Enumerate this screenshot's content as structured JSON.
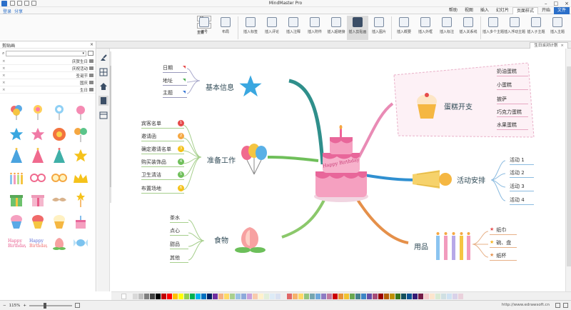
{
  "app": {
    "window_title": "MindMaster Pro",
    "quick_tools": [
      "undo",
      "redo",
      "save",
      "open"
    ]
  },
  "menubar": {
    "items": [
      "文件",
      "开始",
      "页面样式",
      "幻灯片",
      "插入",
      "视图",
      "帮助"
    ],
    "active": "页面样式",
    "left_tools": [
      "登录",
      "分享"
    ]
  },
  "ribbon": {
    "buttons": [
      "插入主题",
      "插入子主题",
      "插入浮动主题",
      "插入多个主题",
      "插入关系线",
      "插入标注",
      "插入外框",
      "插入概要",
      "插入图片",
      "插入剪贴画",
      "插入超链接",
      "插入附件",
      "插入注释",
      "插入评论",
      "插入标签",
      "布局",
      "编号"
    ],
    "selected": "插入剪贴画",
    "spin_values": [
      "40",
      "40"
    ],
    "reset_label": "重置"
  },
  "doc_tab": {
    "label": "生日派对计划"
  },
  "left_panel": {
    "title": "剪贴画",
    "search_placeholder": "",
    "categories": [
      "庆贺生日",
      "庆祝活动",
      "圣诞节",
      "国庆",
      "生日"
    ],
    "clipart": [
      "balloons-icon",
      "lollipop-icon",
      "lollipop-icon",
      "candy-icon",
      "star-icon",
      "star-icon",
      "flower-icon",
      "balloons-icon",
      "party-hat-icon",
      "party-hat-icon",
      "party-hat-icon",
      "star-icon",
      "candles-icon",
      "glasses-icon",
      "glasses-icon",
      "crown-icon",
      "gift-icon",
      "gift-icon",
      "mustache-icon",
      "wand-icon",
      "cupcake-icon",
      "cupcake-icon",
      "cupcake-icon",
      "cake-icon",
      "happy-birthday-text-icon",
      "happy-birthday-text-icon",
      "peach-icon",
      "candy-icon"
    ]
  },
  "mindmap": {
    "center": {
      "label": "Happy Birthday"
    },
    "topics": [
      {
        "key": "basic",
        "label": "基本信息",
        "children": [
          "日期",
          "地址",
          "主题"
        ]
      },
      {
        "key": "prep",
        "label": "准备工作",
        "children": [
          "宾客名单",
          "邀请函",
          "确定邀请名单",
          "购买装饰品",
          "卫生清洁",
          "布置场地"
        ]
      },
      {
        "key": "food",
        "label": "食物",
        "children": [
          "茶水",
          "点心",
          "甜品",
          "其他"
        ]
      },
      {
        "key": "cake",
        "label": "蛋糕开支",
        "children": [
          "奶油蛋糕",
          "小蛋糕",
          "披萨",
          "巧克力蛋糕",
          "水果蛋糕"
        ]
      },
      {
        "key": "activity",
        "label": "活动安排",
        "children": [
          "活动 1",
          "活动 2",
          "活动 3",
          "活动 4"
        ]
      },
      {
        "key": "supplies",
        "label": "用品",
        "children": [
          "纸巾",
          "碗、盘",
          "纸杯"
        ]
      }
    ],
    "prep_numbers": [
      "1",
      "2",
      "3",
      "4",
      "5",
      "6"
    ]
  },
  "statusbar": {
    "zoom": "115%",
    "url": "http://www.edrawsoft.cn"
  },
  "colors": {
    "brand_blue": "#2b6fc9",
    "branch_teal": "#2f8f8b",
    "branch_green": "#6fbf5a",
    "branch_pink": "#e98bb5",
    "branch_orange": "#e5904a"
  }
}
